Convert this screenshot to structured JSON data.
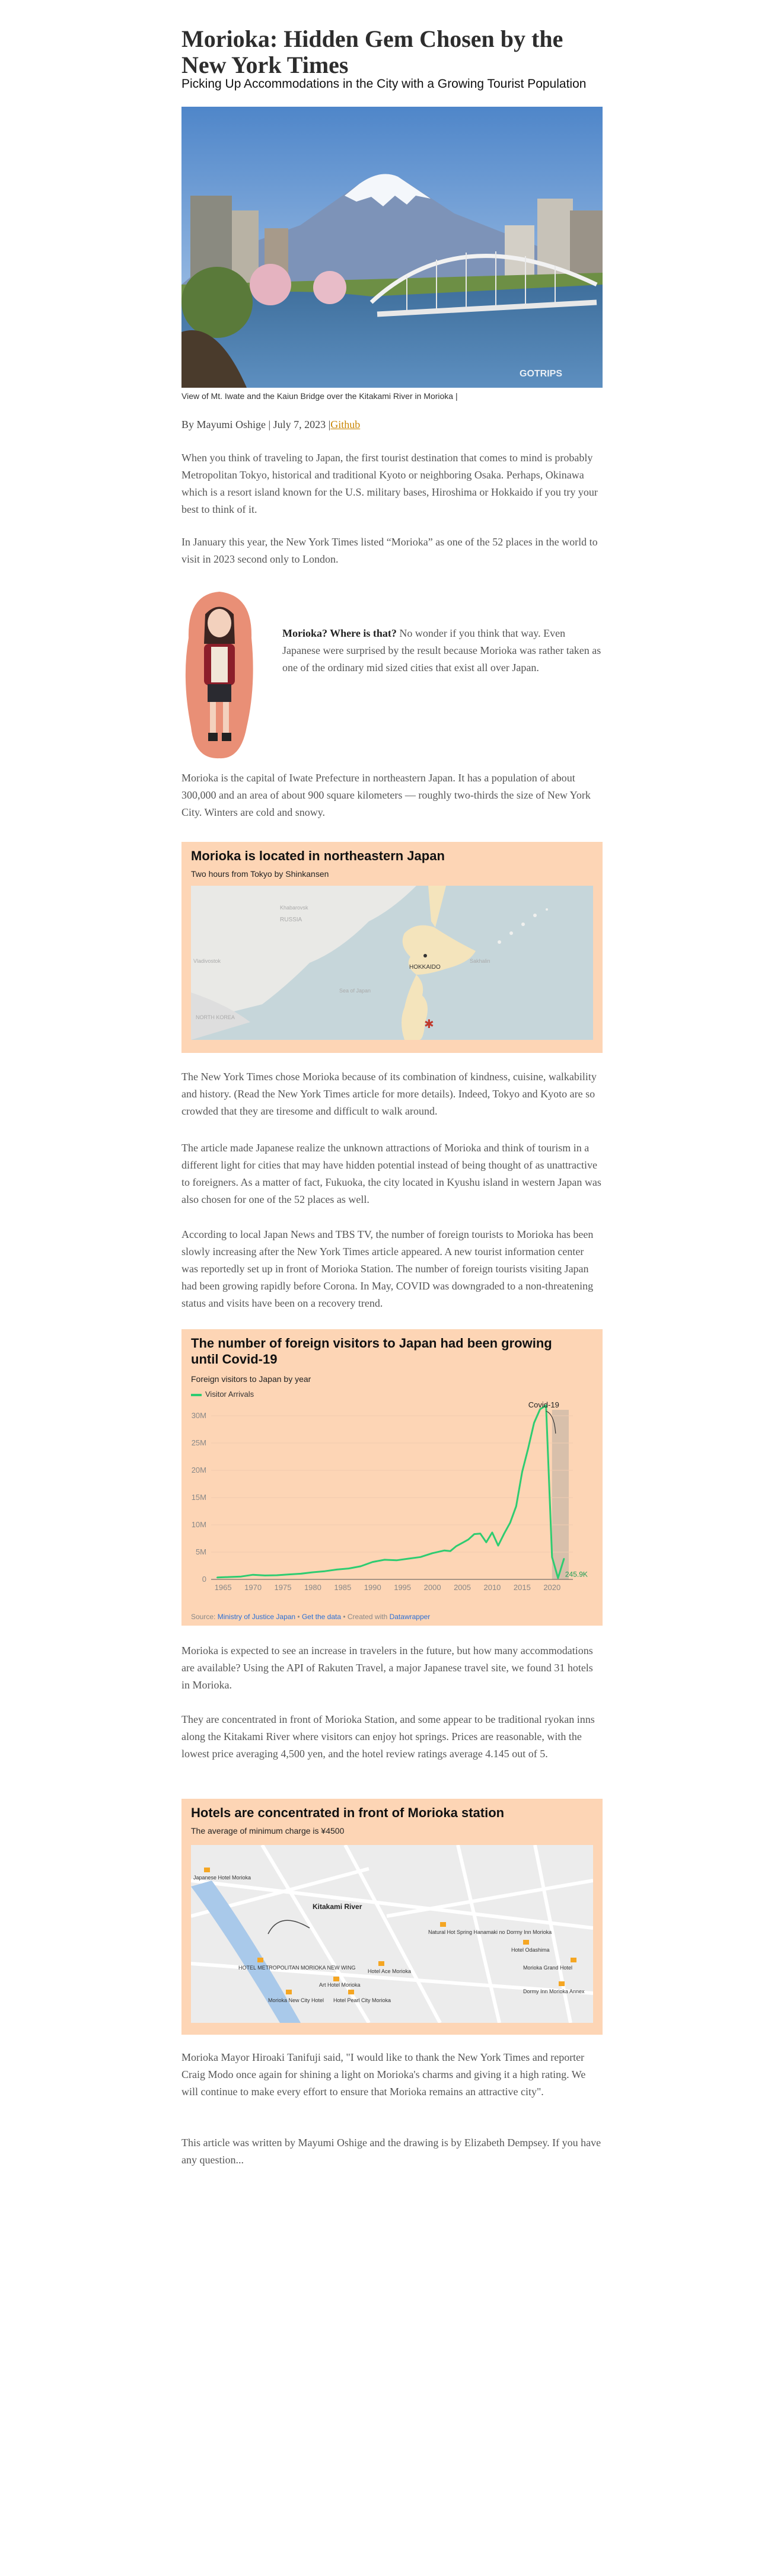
{
  "article": {
    "title": "Morioka: Hidden Gem Chosen by the New York Times",
    "subtitle": "Picking Up Accommodations in the City with a Growing Tourist Population",
    "hero_caption": "View of Mt. Iwate and the Kaiun Bridge over the Kitakami River in Morioka |",
    "hero_watermark": "GOTRIPS",
    "byline": "By Mayumi Oshige | July 7, 2023 |",
    "github_label": "Github",
    "p1": "When you think of traveling to Japan, the first tourist destination that comes to mind is probably Metropolitan Tokyo, historical and traditional Kyoto or neighboring Osaka. Perhaps, Okinawa which is a resort island known for the U.S. military bases, Hiroshima or Hokkaido if you try your best to think of it.",
    "p2": "In January this year, the New York Times listed “Morioka” as one of the 52 places in the world to visit in 2023 second only to London.",
    "aside_bold": "Morioka? Where is that?",
    "aside_text": " No wonder if you think that way. Even Japanese were surprised by the result because Morioka was rather taken as one of the ordinary mid sized cities that exist all over Japan.",
    "p3": "Morioka is the capital of Iwate Prefecture in northeastern Japan. It has a population of about 300,000 and an area of about 900 square kilometers — roughly two-thirds the size of New York City. Winters are cold and snowy.",
    "p4": "The New York Times chose Morioka because of its combination of kindness, cuisine, walkability and history. (Read the New York Times article for more details). Indeed, Tokyo and Kyoto are so crowded that they are tiresome and difficult to walk around.",
    "p5": "The article made Japanese realize the unknown attractions of Morioka and think of tourism in a different light for cities that may have hidden potential instead of being thought of as unattractive to foreigners. As a matter of fact, Fukuoka, the city located in Kyushu island in western Japan was also chosen for one of the 52 places as well.",
    "p6": "According to local Japan News and TBS TV, the number of foreign tourists to Morioka has been slowly increasing after the New York Times article appeared. A new tourist information center was reportedly set up in front of Morioka Station. The number of foreign tourists visiting Japan had been growing rapidly before Corona. In May, COVID was downgraded to a non-threatening status and visits have been on a recovery trend.",
    "p7": "Morioka is expected to see an increase in travelers in the future, but how many accommodations are available? Using the API of Rakuten Travel, a major Japanese travel site, we found 31 hotels in Morioka.",
    "p8": "They are concentrated in front of Morioka Station, and some appear to be traditional ryokan inns along the Kitakami River where visitors can enjoy hot springs. Prices are reasonable, with the lowest price averaging 4,500 yen, and the hotel review ratings average 4.145 out of 5.",
    "p9": "Morioka Mayor Hiroaki Tanifuji said, \"I would like to thank the New York Times and reporter Craig Modo once again for shining a light on Morioka's charms and giving it a high rating. We will continue to make every effort to ensure that Morioka remains an attractive city\".",
    "p10": "This article was written by Mayumi Oshige and the drawing is by Elizabeth Dempsey. If you have any question..."
  },
  "map1": {
    "title": "Morioka is located in northeastern Japan",
    "subtitle": "Two hours from Tokyo by Shinkansen",
    "labels": {
      "russia": "RUSSIA",
      "hokkaido": "HOKKAIDO",
      "khabarovsk": "Khabarovsk",
      "vladivostok": "Vladivostok",
      "north_korea": "NORTH KOREA",
      "sakhalin": "Sakhalin",
      "sea": "Sea of Japan"
    },
    "colors": {
      "land": "#f4e4bc",
      "water": "#c6d6da",
      "marker": "#c0392b"
    }
  },
  "visitors_chart": {
    "title": "The number of foreign visitors to Japan had been growing until Covid-19",
    "subtitle": "Foreign visitors to Japan by year",
    "legend": "Visitor Arrivals",
    "annotation": "Covid-19",
    "end_label": "245.9K",
    "source_prefix": "Source: ",
    "source_link": "Ministry of Justice Japan",
    "get_data": "Get the data",
    "created_with": " • Created with ",
    "tool": "Datawrapper",
    "colors": {
      "line": "#2ecc71",
      "shade": "#c8b6a6"
    }
  },
  "chart_data": {
    "type": "line",
    "title": "The number of foreign visitors to Japan had been growing until Covid-19",
    "ylabel": "",
    "xlabel": "",
    "ylim": [
      0,
      30000000
    ],
    "yticks": [
      0,
      5000000,
      10000000,
      15000000,
      20000000,
      25000000,
      30000000
    ],
    "ytick_labels": [
      "0",
      "5M",
      "10M",
      "15M",
      "20M",
      "25M",
      "30M"
    ],
    "xticks": [
      1965,
      1970,
      1975,
      1980,
      1985,
      1990,
      1995,
      2000,
      2005,
      2010,
      2015,
      2020
    ],
    "series": [
      {
        "name": "Visitor Arrivals",
        "x": [
          1964,
          1966,
          1968,
          1970,
          1972,
          1974,
          1976,
          1978,
          1980,
          1982,
          1984,
          1986,
          1988,
          1990,
          1992,
          1994,
          1996,
          1998,
          2000,
          2002,
          2003,
          2004,
          2005,
          2006,
          2007,
          2008,
          2009,
          2010,
          2011,
          2012,
          2013,
          2014,
          2015,
          2016,
          2017,
          2018,
          2019,
          2020,
          2021,
          2022
        ],
        "values": [
          350000,
          430000,
          520000,
          850000,
          720000,
          760000,
          910000,
          1040000,
          1300000,
          1500000,
          1800000,
          2000000,
          2400000,
          3200000,
          3600000,
          3500000,
          3800000,
          4100000,
          4800000,
          5300000,
          5200000,
          6100000,
          6700000,
          7300000,
          8300000,
          8400000,
          6800000,
          8600000,
          6200000,
          8400000,
          10400000,
          13400000,
          19700000,
          24000000,
          28700000,
          31200000,
          31900000,
          4100000,
          245900,
          3800000
        ]
      }
    ],
    "annotation": {
      "x": 2020,
      "text": "Covid-19"
    },
    "shaded_range": [
      2020,
      2022
    ]
  },
  "hotel_map": {
    "title": "Hotels are concentrated in front of Morioka station",
    "subtitle": "The average of minimum charge is ¥4500",
    "river_label": "Kitakami River",
    "hotels": [
      "Japanese Hotel Morioka",
      "HOTEL METROPOLITAN MORIOKA NEW WING",
      "Morioka New City Hotel",
      "Hotel Pearl City Morioka",
      "Art Hotel Morioka",
      "Hotel Ace Morioka",
      "Natural Hot Spring Hanamaki no Dormy Inn Morioka",
      "Hotel Odashima",
      "Morioka Grand Hotel",
      "Dormy Inn Morioka Annex"
    ],
    "colors": {
      "pin": "#f5a623",
      "base": "#ececec"
    }
  }
}
